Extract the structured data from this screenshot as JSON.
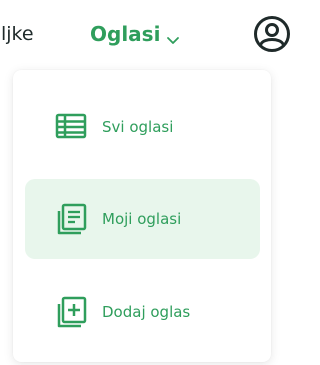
{
  "nav": {
    "prev_label_partial": "ljke",
    "current_label": "Oglasi",
    "chevron_icon": "chevron-down-icon",
    "account_icon": "user-circle-icon"
  },
  "dropdown": {
    "items": [
      {
        "label": "Svi oglasi",
        "icon": "table-list-icon",
        "active": false
      },
      {
        "label": "Moji oglasi",
        "icon": "stacked-document-icon",
        "active": true
      },
      {
        "label": "Dodaj oglas",
        "icon": "add-document-icon",
        "active": false
      }
    ]
  },
  "colors": {
    "accent": "#2f9e5c",
    "active_bg": "#e8f6ec",
    "text": "#1f2a2a"
  }
}
